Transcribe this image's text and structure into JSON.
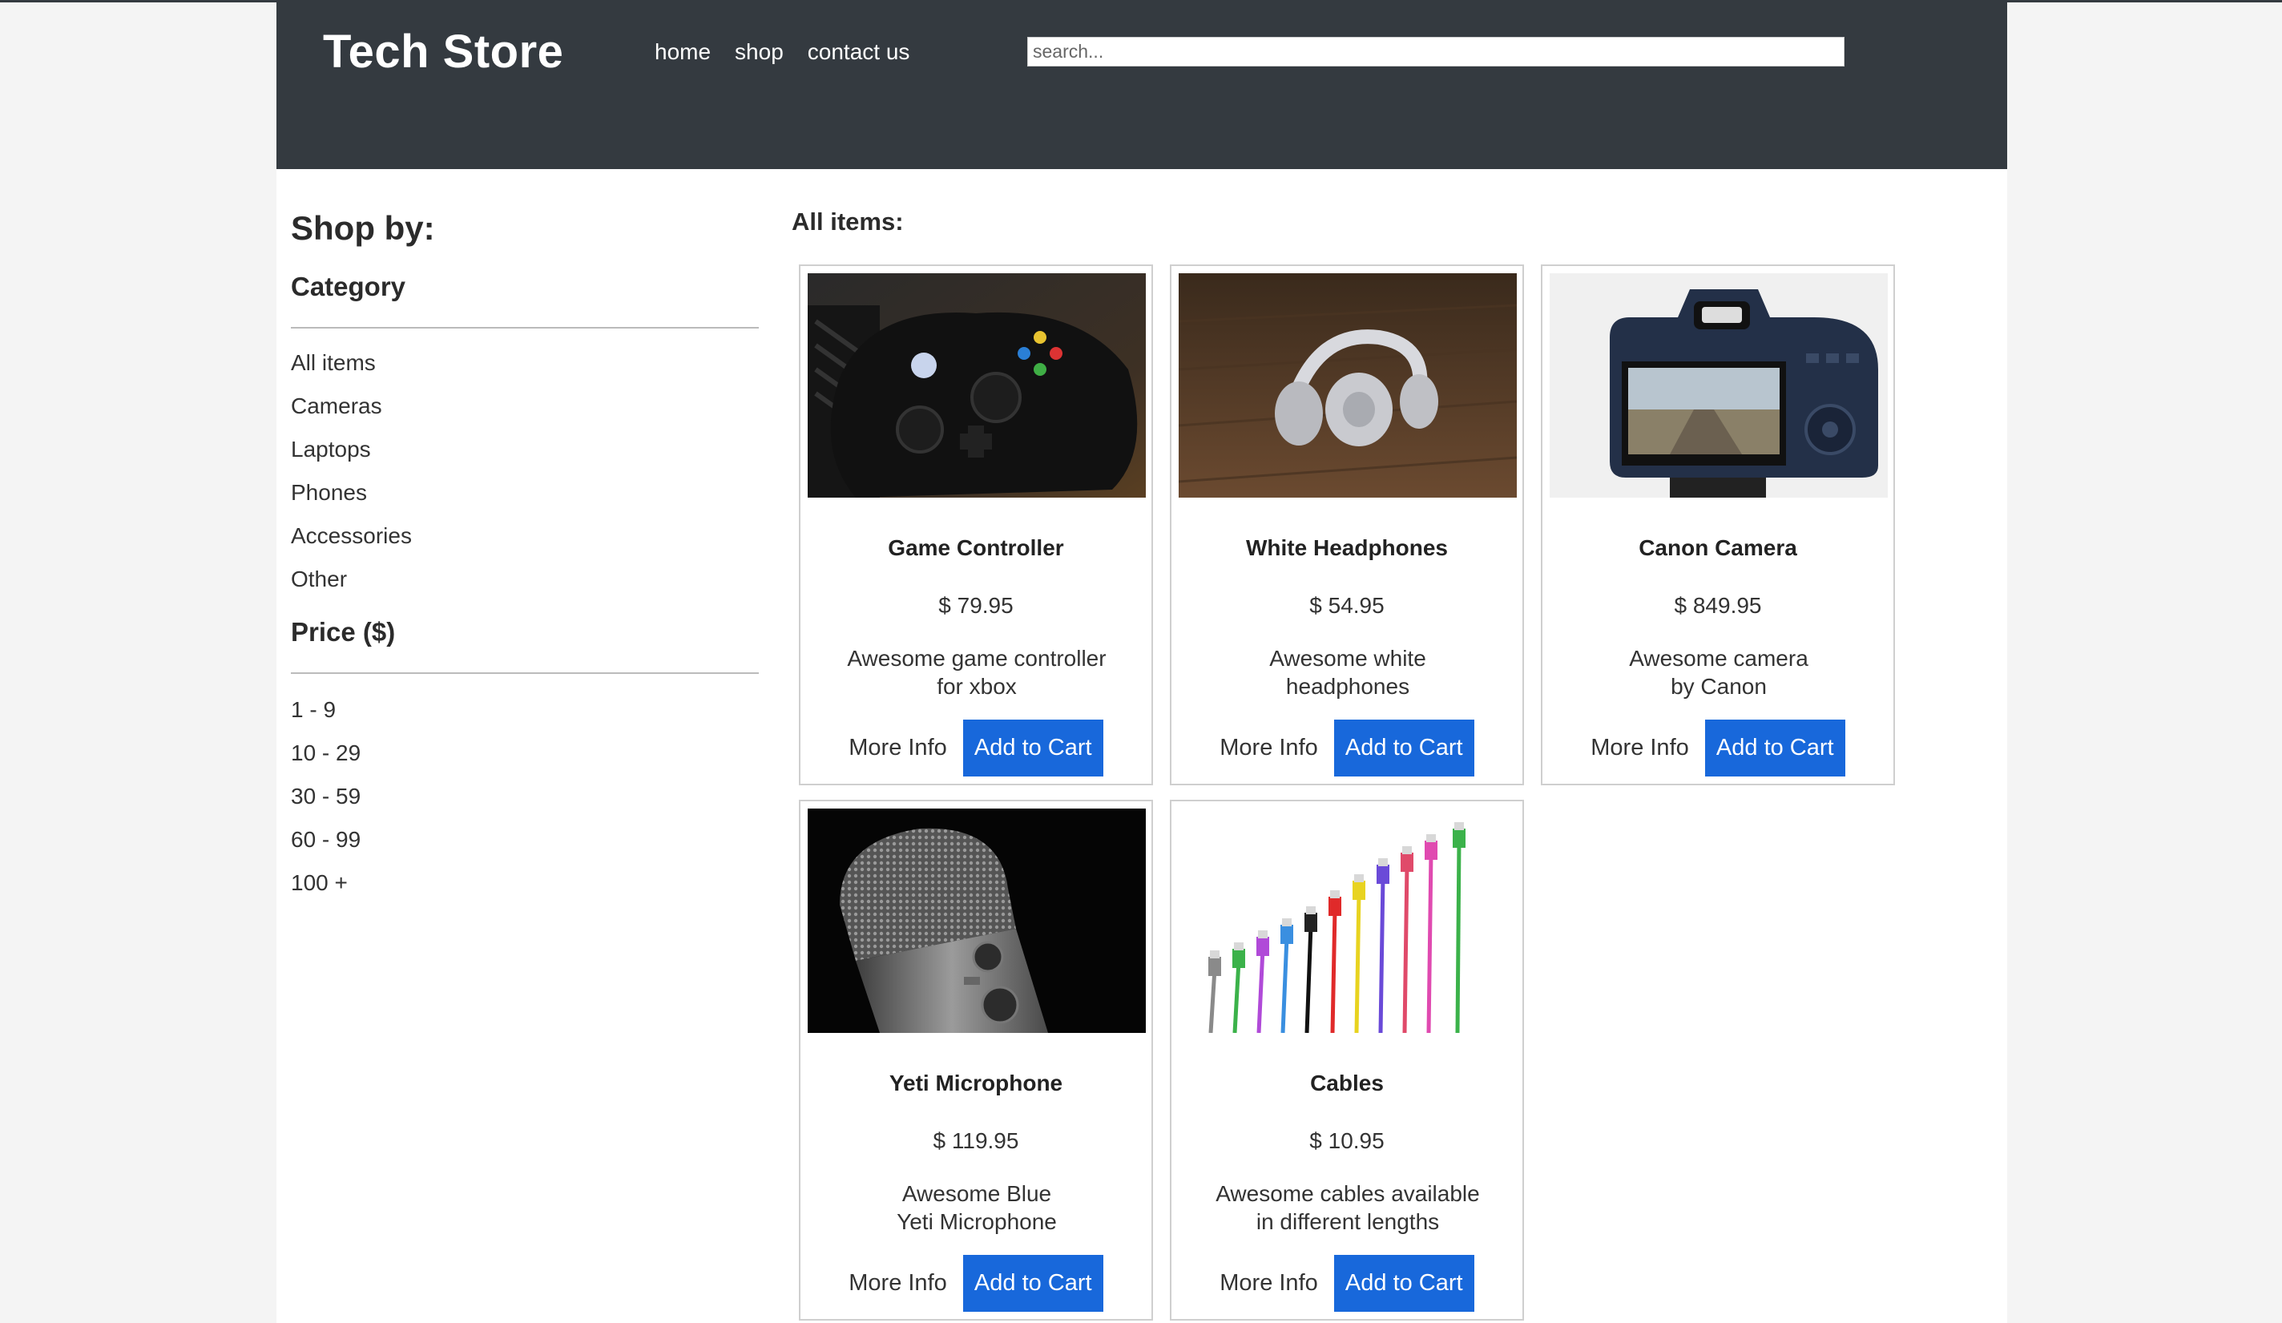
{
  "header": {
    "brand": "Tech Store",
    "nav": [
      "home",
      "shop",
      "contact us"
    ],
    "search_placeholder": "search..."
  },
  "sidebar": {
    "title": "Shop by:",
    "category_heading": "Category",
    "categories": [
      "All items",
      "Cameras",
      "Laptops",
      "Phones",
      "Accessories",
      "Other"
    ],
    "price_heading": "Price ($)",
    "prices": [
      "1 - 9",
      "10 - 29",
      "30 - 59",
      "60 - 99",
      "100 +"
    ]
  },
  "main": {
    "heading": "All items:",
    "more_info_label": "More Info",
    "add_to_cart_label": "Add to Cart",
    "products": [
      {
        "name": "Game Controller",
        "price": "$ 79.95",
        "desc1": "Awesome game controller",
        "desc2": "for xbox",
        "image": "game-controller"
      },
      {
        "name": "White Headphones",
        "price": "$ 54.95",
        "desc1": "Awesome white",
        "desc2": "headphones",
        "image": "headphones"
      },
      {
        "name": "Canon Camera",
        "price": "$ 849.95",
        "desc1": "Awesome camera",
        "desc2": "by Canon",
        "image": "camera"
      },
      {
        "name": "Yeti Microphone",
        "price": "$ 119.95",
        "desc1": "Awesome Blue",
        "desc2": "Yeti Microphone",
        "image": "microphone"
      },
      {
        "name": "Cables",
        "price": "$ 10.95",
        "desc1": "Awesome cables available",
        "desc2": "in different lengths",
        "image": "cables"
      }
    ]
  },
  "colors": {
    "header_bg": "#343a40",
    "button_blue": "#1868db",
    "page_bg": "#f4f4f4"
  }
}
